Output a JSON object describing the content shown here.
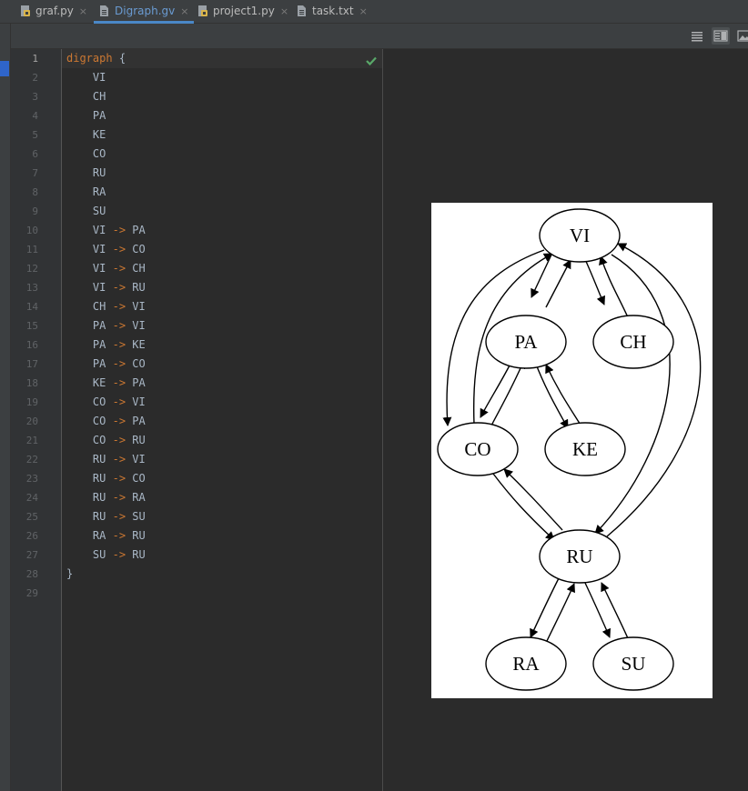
{
  "tabs": [
    {
      "label": "graf.py",
      "icon": "python-file-icon",
      "close": "×",
      "active": false
    },
    {
      "label": "Digraph.gv",
      "icon": "text-file-icon",
      "close": "×",
      "active": true
    },
    {
      "label": "project1.py",
      "icon": "python-file-icon",
      "close": "×",
      "active": false
    },
    {
      "label": "task.txt",
      "icon": "text-file-icon",
      "close": "×",
      "active": false
    }
  ],
  "toolbar": {
    "buttons": [
      "editor-only-icon",
      "editor-and-preview-icon",
      "preview-only-icon"
    ],
    "active": "editor-and-preview-icon"
  },
  "editor": {
    "line_numbers": [
      "1",
      "2",
      "3",
      "4",
      "5",
      "6",
      "7",
      "8",
      "9",
      "10",
      "11",
      "12",
      "13",
      "14",
      "15",
      "16",
      "17",
      "18",
      "19",
      "20",
      "21",
      "22",
      "23",
      "24",
      "25",
      "26",
      "27",
      "28",
      "29"
    ],
    "current_line": "1",
    "open": {
      "keyword": "digraph",
      "brace": "{"
    },
    "nodes": [
      "VI",
      "CH",
      "PA",
      "KE",
      "CO",
      "RU",
      "RA",
      "SU"
    ],
    "edges": [
      {
        "from": "VI",
        "to": "PA"
      },
      {
        "from": "VI",
        "to": "CO"
      },
      {
        "from": "VI",
        "to": "CH"
      },
      {
        "from": "VI",
        "to": "RU"
      },
      {
        "from": "CH",
        "to": "VI"
      },
      {
        "from": "PA",
        "to": "VI"
      },
      {
        "from": "PA",
        "to": "KE"
      },
      {
        "from": "PA",
        "to": "CO"
      },
      {
        "from": "KE",
        "to": "PA"
      },
      {
        "from": "CO",
        "to": "VI"
      },
      {
        "from": "CO",
        "to": "PA"
      },
      {
        "from": "CO",
        "to": "RU"
      },
      {
        "from": "RU",
        "to": "VI"
      },
      {
        "from": "RU",
        "to": "CO"
      },
      {
        "from": "RU",
        "to": "RA"
      },
      {
        "from": "RU",
        "to": "SU"
      },
      {
        "from": "RA",
        "to": "RU"
      },
      {
        "from": "SU",
        "to": "RU"
      }
    ],
    "arrow": "->",
    "close_brace": "}",
    "status_icon": "checkmark-icon"
  },
  "preview": {
    "nodes": [
      "VI",
      "PA",
      "CH",
      "CO",
      "KE",
      "RU",
      "RA",
      "SU"
    ]
  }
}
